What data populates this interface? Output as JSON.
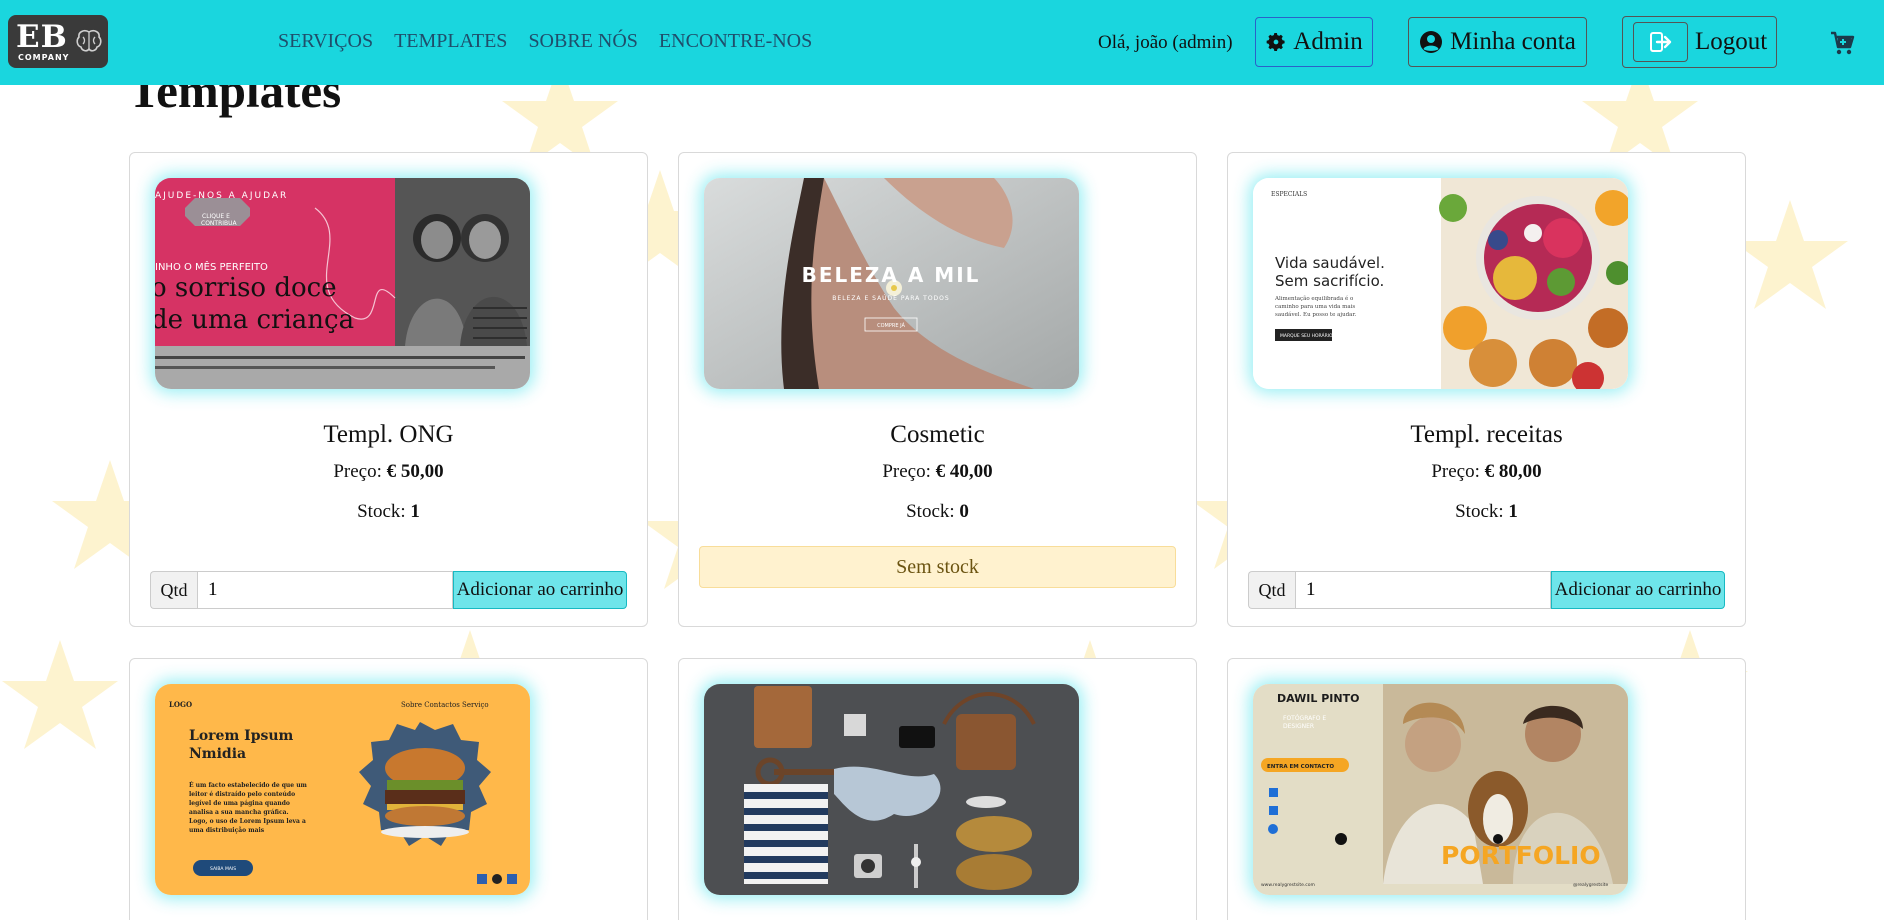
{
  "logo": {
    "text": "EB",
    "subtext": "COMPANY"
  },
  "nav": {
    "links": [
      "SERVIÇOS",
      "TEMPLATES",
      "SOBRE NÓS",
      "ENCONTRE-NOS"
    ]
  },
  "header": {
    "greeting": "Olá, joão (admin)",
    "admin_label": "Admin",
    "account_label": "Minha conta",
    "logout_label": "Logout"
  },
  "page": {
    "title": "Templates"
  },
  "labels": {
    "price_prefix": "Preço: ",
    "stock_prefix": "Stock: ",
    "qty": "Qtd",
    "add_to_cart": "Adicionar ao carrinho",
    "no_stock": "Sem stock"
  },
  "products": [
    {
      "title": "Templ. ONG",
      "price": "€ 50,00",
      "stock": "1",
      "qty": "1"
    },
    {
      "title": "Cosmetic",
      "price": "€ 40,00",
      "stock": "0"
    },
    {
      "title": "Templ. receitas",
      "price": "€ 80,00",
      "stock": "1",
      "qty": "1"
    },
    {
      "title": "",
      "price": "",
      "stock": ""
    },
    {
      "title": "",
      "price": "",
      "stock": ""
    },
    {
      "title": "",
      "price": "",
      "stock": ""
    }
  ],
  "thumbnails": {
    "ong": {
      "top": "AJUDE-NOS A AJUDAR",
      "badge1": "CLIQUE E",
      "badge2": "CONTRIBUA",
      "line1": "INHO O MÊS PERFEITO",
      "line2": "o sorriso doce",
      "line3": "de uma criança"
    },
    "cosmetic": {
      "title": "BELEZA A MIL",
      "subtitle": "BELEZA E SAÚDE PARA TODOS",
      "cta": "COMPRE JÁ"
    },
    "receitas": {
      "brand": "ESPECIALS",
      "headline1": "Vida saudável.",
      "headline2": "Sem sacrifício.",
      "body1": "Alimentação equilibrada é o",
      "body2": "caminho para uma vida mais",
      "body3": "saudável. Eu posso te ajudar.",
      "cta": "MARQUE SEU HORÁRIO"
    },
    "burger": {
      "logo": "LOGO",
      "menu": "Sobre  Contactos  Serviço",
      "title1": "Lorem Ipsum",
      "title2": "Nmidia",
      "body1": "É um facto estabelecido de que um",
      "body2": "leitor é distraído pelo conteúdo",
      "body3": "legível de uma página quando",
      "body4": "analisa a sua mancha gráfica.",
      "body5": "Logo, o uso de Lorem Ipsum leva a",
      "body6": "uma distribuição mais",
      "cta": "SAIBA MAIS"
    },
    "portfolio": {
      "name": "DAWIL PINTO",
      "role1": "FOTÓGRAFO E",
      "role2": "DESIGNER",
      "cta": "ENTRA EM CONTACTO",
      "big": "PORTFOLIO",
      "footer_left": "www.realygrestsite.com",
      "footer_right": "@realygrestsite"
    }
  },
  "colors": {
    "navbar": "#1ad6de",
    "accent_button": "#6ee5ea",
    "no_stock_bg": "#fff2cf",
    "star": "#fdf3cf"
  },
  "icons": [
    "brain-icon",
    "gear-icon",
    "user-circle-icon",
    "logout-icon",
    "cart-icon"
  ]
}
